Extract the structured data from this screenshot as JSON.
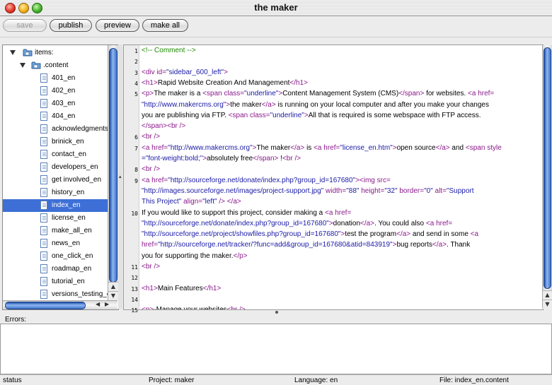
{
  "window": {
    "title": "the maker"
  },
  "toolbar": {
    "save": "save",
    "publish": "publish",
    "preview": "preview",
    "make_all": "make all"
  },
  "tree": {
    "root": "items:",
    "folder": ".content",
    "files": [
      "401_en",
      "402_en",
      "403_en",
      "404_en",
      "acknowledgments",
      "brinick_en",
      "contact_en",
      "developers_en",
      "get involved_en",
      "history_en",
      "index_en",
      "license_en",
      "make_all_en",
      "news_en",
      "one_click_en",
      "roadmap_en",
      "tutorial_en",
      "versions_testing_e"
    ],
    "selected": "index_en"
  },
  "editor": {
    "line_numbers": [
      "1",
      "2",
      "3",
      "4",
      "5",
      "6",
      "7",
      "8",
      "9",
      "10",
      "11",
      "12",
      "13",
      "14",
      "15"
    ],
    "lines": [
      {
        "n": "1",
        "parts": [
          [
            "com",
            "<!-- Comment -->"
          ]
        ]
      },
      {
        "n": "2",
        "parts": []
      },
      {
        "n": "3",
        "parts": [
          [
            "tag",
            "<div "
          ],
          [
            "attr",
            "id="
          ],
          [
            "val",
            "\"sidebar_600_left\""
          ],
          [
            "tag",
            ">"
          ]
        ]
      },
      {
        "n": "4",
        "parts": [
          [
            "tag",
            "<h1>"
          ],
          [
            "txt",
            "Rapid Website Creation And Management"
          ],
          [
            "tag",
            "</h1>"
          ]
        ]
      },
      {
        "n": "5",
        "parts": [
          [
            "tag",
            "<p>"
          ],
          [
            "txt",
            "The maker is a "
          ],
          [
            "tag",
            "<span "
          ],
          [
            "attr",
            "class="
          ],
          [
            "val",
            "\"underline\""
          ],
          [
            "tag",
            ">"
          ],
          [
            "txt",
            "Content Management System (CMS)"
          ],
          [
            "tag",
            "</span>"
          ],
          [
            "txt",
            " for websites. "
          ],
          [
            "tag",
            "<a href="
          ]
        ]
      },
      {
        "n": "",
        "parts": [
          [
            "val",
            "\"http://www.makercms.org\""
          ],
          [
            "tag",
            ">"
          ],
          [
            "txt",
            "the maker"
          ],
          [
            "tag",
            "</a>"
          ],
          [
            "txt",
            " is running on your local computer and after you make your changes"
          ]
        ]
      },
      {
        "n": "",
        "parts": [
          [
            "txt",
            "you are publishing  via FTP. "
          ],
          [
            "tag",
            "<span "
          ],
          [
            "attr",
            "class="
          ],
          [
            "val",
            "\"underline\""
          ],
          [
            "tag",
            ">"
          ],
          [
            "txt",
            "All that is required is  some webspace with FTP access."
          ]
        ]
      },
      {
        "n": "",
        "parts": [
          [
            "tag",
            "</span><br />"
          ]
        ]
      },
      {
        "n": "6",
        "parts": [
          [
            "tag",
            "<br />"
          ]
        ]
      },
      {
        "n": "7",
        "parts": [
          [
            "tag",
            "<a href="
          ],
          [
            "val",
            "\"http://www.makercms.org\""
          ],
          [
            "tag",
            ">"
          ],
          [
            "txt",
            "The maker"
          ],
          [
            "tag",
            "</a>"
          ],
          [
            "txt",
            " is "
          ],
          [
            "tag",
            "<a href="
          ],
          [
            "val",
            "\"license_en.htm\""
          ],
          [
            "tag",
            ">"
          ],
          [
            "txt",
            "open source"
          ],
          [
            "tag",
            "</a>"
          ],
          [
            "txt",
            " and "
          ],
          [
            "tag",
            "<span style"
          ]
        ]
      },
      {
        "n": "",
        "parts": [
          [
            "val",
            "=\"font-weight:bold;\""
          ],
          [
            "tag",
            ">"
          ],
          [
            "txt",
            "absolutely free"
          ],
          [
            "tag",
            "</span>"
          ],
          [
            "txt",
            " !"
          ],
          [
            "tag",
            "<br />"
          ]
        ]
      },
      {
        "n": "8",
        "parts": [
          [
            "tag",
            "<br />"
          ]
        ]
      },
      {
        "n": "9",
        "parts": [
          [
            "tag",
            "<a href="
          ],
          [
            "val",
            "\"http://sourceforge.net/donate/index.php?group_id=167680\""
          ],
          [
            "tag",
            "><img src="
          ]
        ]
      },
      {
        "n": "",
        "parts": [
          [
            "val",
            "\"http://images.sourceforge.net/images/project-support.jpg\""
          ],
          [
            "attr",
            " width="
          ],
          [
            "val",
            "\"88\""
          ],
          [
            "attr",
            " height="
          ],
          [
            "val",
            "\"32\""
          ],
          [
            "attr",
            " border="
          ],
          [
            "val",
            "\"0\""
          ],
          [
            "attr",
            " alt="
          ],
          [
            "val",
            "\"Support"
          ]
        ]
      },
      {
        "n": "",
        "parts": [
          [
            "val",
            "This Project\""
          ],
          [
            "attr",
            " align="
          ],
          [
            "val",
            "\"left\""
          ],
          [
            "tag",
            " /> </a>"
          ]
        ]
      },
      {
        "n": "10",
        "parts": [
          [
            "txt",
            "If you would like to support this project, consider making a "
          ],
          [
            "tag",
            "<a href="
          ]
        ]
      },
      {
        "n": "",
        "parts": [
          [
            "val",
            "\"http://sourceforge.net/donate/index.php?group_id=167680\""
          ],
          [
            "tag",
            ">"
          ],
          [
            "txt",
            "donation"
          ],
          [
            "tag",
            "</a>"
          ],
          [
            "txt",
            ". You could also "
          ],
          [
            "tag",
            "<a href="
          ]
        ]
      },
      {
        "n": "",
        "parts": [
          [
            "val",
            "\"http://sourceforge.net/project/showfiles.php?group_id=167680\""
          ],
          [
            "tag",
            ">"
          ],
          [
            "txt",
            "test the program"
          ],
          [
            "tag",
            "</a>"
          ],
          [
            "txt",
            " and send in some "
          ],
          [
            "tag",
            "<a"
          ]
        ]
      },
      {
        "n": "",
        "parts": [
          [
            "tag",
            "href="
          ],
          [
            "val",
            "\"http://sourceforge.net/tracker/?func=add&group_id=167680&atid=843919\""
          ],
          [
            "tag",
            ">"
          ],
          [
            "txt",
            "bug reports"
          ],
          [
            "tag",
            "</a>"
          ],
          [
            "txt",
            ".  Thank"
          ]
        ]
      },
      {
        "n": "",
        "parts": [
          [
            "txt",
            "you for supporting the maker."
          ],
          [
            "tag",
            "</p>"
          ]
        ]
      },
      {
        "n": "11",
        "parts": [
          [
            "tag",
            "<br />"
          ]
        ]
      },
      {
        "n": "12",
        "parts": []
      },
      {
        "n": "13",
        "parts": [
          [
            "tag",
            "<h1>"
          ],
          [
            "txt",
            "Main Features"
          ],
          [
            "tag",
            "</h1>"
          ]
        ]
      },
      {
        "n": "14",
        "parts": []
      },
      {
        "n": "15",
        "parts": [
          [
            "tag",
            "<p>"
          ],
          [
            "txt",
            "-Manage your websites"
          ],
          [
            "tag",
            "<br />"
          ]
        ]
      }
    ]
  },
  "errors": {
    "label": "Errors:"
  },
  "status": {
    "status": "status",
    "project": "Project: maker",
    "language": "Language: en",
    "file": "File: index_en.content"
  },
  "colors": {
    "selection": "#3d6fd6",
    "tag": "#8b1a8b",
    "value": "#1a1aa6",
    "comment": "#1e8a00"
  },
  "icons": [
    "close-light-icon",
    "minimize-light-icon",
    "zoom-light-icon",
    "folder-icon",
    "document-icon",
    "disclosure-triangle-icon",
    "scroll-up-arrow-icon",
    "scroll-down-arrow-icon",
    "scroll-left-arrow-icon",
    "scroll-right-arrow-icon"
  ]
}
